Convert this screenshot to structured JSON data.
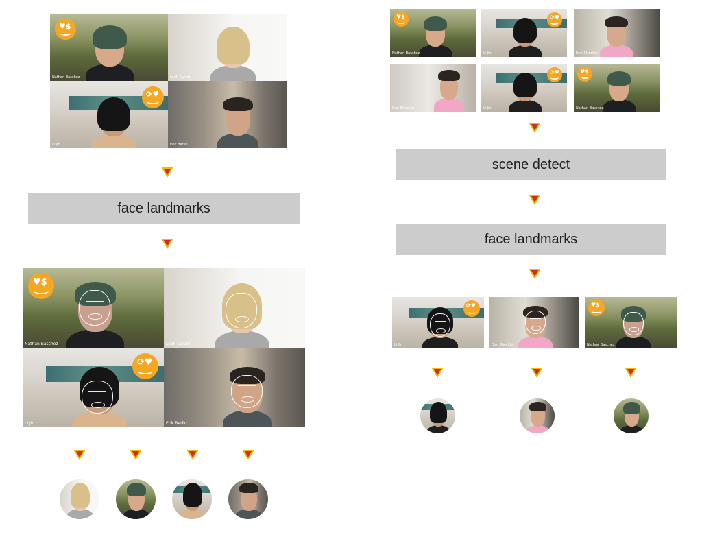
{
  "colors": {
    "step_bar": "#cccccc",
    "arrow_fill": "#d12a2a",
    "arrow_edge": "#f5b700",
    "emoji": "#f5a623",
    "divider": "#bdbdbd"
  },
  "participants": {
    "nathan": "Nathan Baschez",
    "leah": "Leah Culver",
    "li": "Li Jin",
    "erik": "Erik Berlin",
    "dan": "Dan Sheckler"
  },
  "left": {
    "step_face_landmarks": "face landmarks",
    "input_grid_icon": "video-call-grid-2x2",
    "output_faces_count": 4
  },
  "right": {
    "step_scene_detect": "scene detect",
    "step_face_landmarks": "face landmarks",
    "input_grid_icon": "video-call-grid-3x2",
    "output_faces_count": 3
  }
}
